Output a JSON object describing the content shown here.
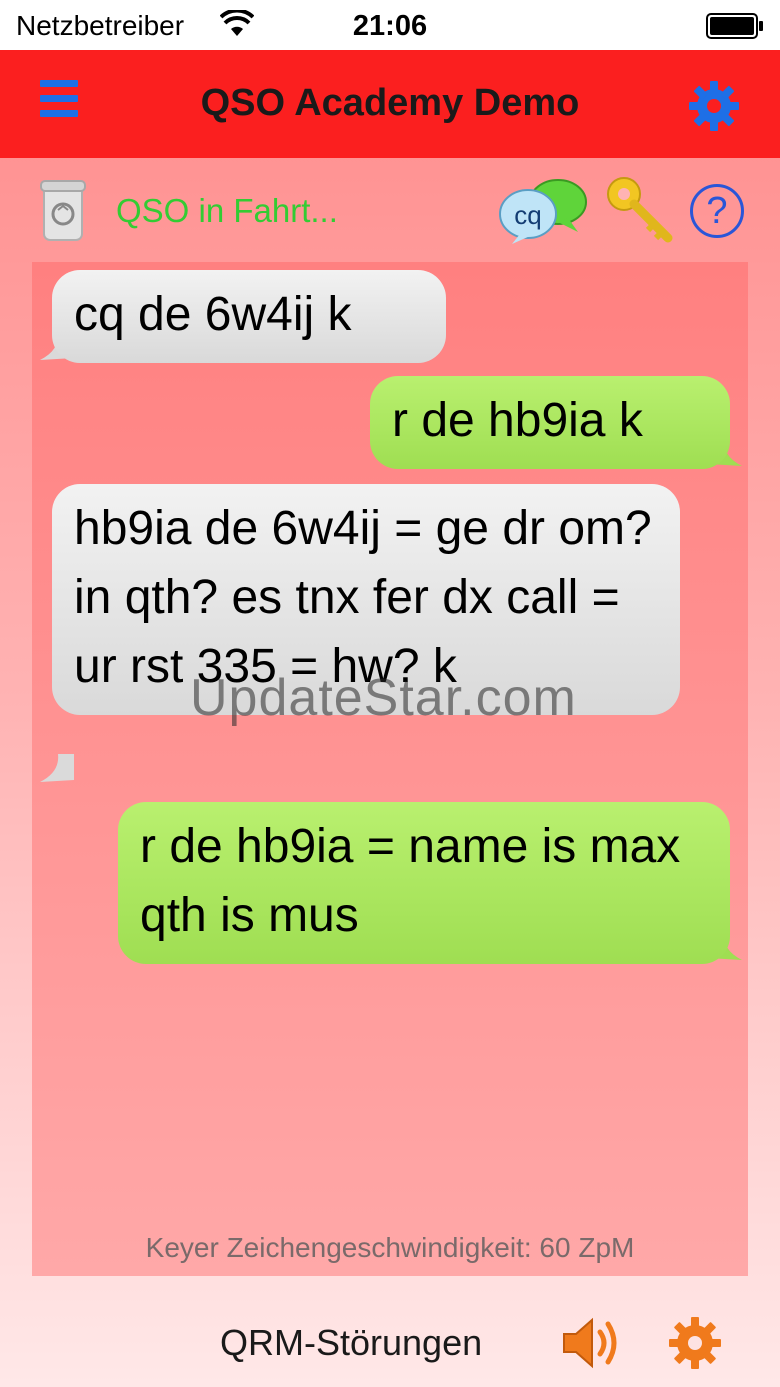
{
  "status_bar": {
    "carrier": "Netzbetreiber",
    "time": "21:06"
  },
  "nav": {
    "title": "QSO Academy Demo"
  },
  "toolbar": {
    "status_text": "QSO in Fahrt...",
    "cq_icon_label": "cq",
    "help_label": "?"
  },
  "messages": [
    {
      "side": "in",
      "text": "cq de 6w4ij k"
    },
    {
      "side": "out",
      "text": "r de hb9ia k"
    },
    {
      "side": "in",
      "text": "hb9ia de 6w4ij = ge dr om? in qth? es tnx fer dx call = ur rst 335 = hw? k"
    },
    {
      "side": "out",
      "text": "r de hb9ia = name is max qth is mus"
    }
  ],
  "watermark": "UpdateStar.com",
  "speed_text": "Keyer Zeichengeschwindigkeit: 60 ZpM",
  "bottom": {
    "qrm_label": "QRM-Störungen"
  },
  "colors": {
    "nav_bar": "#fb1f1f",
    "accent_blue": "#1e6fe6",
    "status_green": "#33cc33",
    "bubble_out": "#a8e45c",
    "bubble_in": "#e6e6e6",
    "bottom_icons": "#f07a1c"
  },
  "icons": [
    "menu-icon",
    "gear-icon",
    "trash-icon",
    "cq-chat-icon",
    "key-icon",
    "help-icon",
    "speaker-icon",
    "gear-icon"
  ]
}
